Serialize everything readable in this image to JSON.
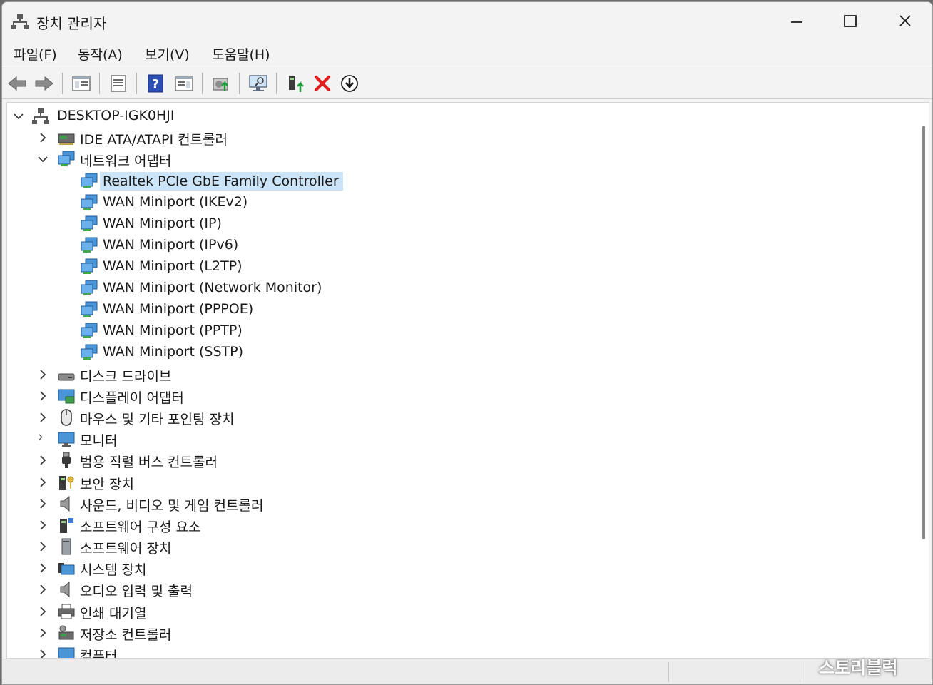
{
  "window": {
    "title": "장치 관리자"
  },
  "menu": {
    "items": [
      "파일(F)",
      "동작(A)",
      "보기(V)",
      "도움말(H)"
    ]
  },
  "toolbar": {
    "buttons": [
      "back-arrow-icon",
      "forward-arrow-icon",
      "show-hide-tree-icon",
      "properties-icon",
      "help-icon",
      "action-pane-icon",
      "update-driver-icon",
      "scan-hardware-icon",
      "add-legacy-icon",
      "uninstall-icon",
      "disable-device-icon"
    ]
  },
  "tree": {
    "root": "DESKTOP-IGK0HJI",
    "nodes": [
      {
        "label": "IDE ATA/ATAPI 컨트롤러",
        "icon": "ide-controller-icon",
        "expanded": false
      },
      {
        "label": "네트워크 어댑터",
        "icon": "network-adapter-icon",
        "expanded": true,
        "children": [
          {
            "label": "Realtek PCIe GbE Family Controller",
            "selected": true
          },
          {
            "label": "WAN Miniport (IKEv2)"
          },
          {
            "label": "WAN Miniport (IP)"
          },
          {
            "label": "WAN Miniport (IPv6)"
          },
          {
            "label": "WAN Miniport (L2TP)"
          },
          {
            "label": "WAN Miniport (Network Monitor)"
          },
          {
            "label": "WAN Miniport (PPPOE)"
          },
          {
            "label": "WAN Miniport (PPTP)"
          },
          {
            "label": "WAN Miniport (SSTP)"
          }
        ]
      },
      {
        "label": "디스크 드라이브",
        "icon": "disk-drive-icon",
        "expanded": false
      },
      {
        "label": "디스플레이 어댑터",
        "icon": "display-adapter-icon",
        "expanded": false
      },
      {
        "label": "마우스 및 기타 포인팅 장치",
        "icon": "mouse-icon",
        "expanded": false
      },
      {
        "label": "모니터",
        "icon": "monitor-icon",
        "expanded": false
      },
      {
        "label": "범용 직렬 버스 컨트롤러",
        "icon": "usb-icon",
        "expanded": false
      },
      {
        "label": "보안 장치",
        "icon": "security-device-icon",
        "expanded": false
      },
      {
        "label": "사운드, 비디오 및 게임 컨트롤러",
        "icon": "speaker-icon",
        "expanded": false
      },
      {
        "label": "소프트웨어 구성 요소",
        "icon": "software-component-icon",
        "expanded": false
      },
      {
        "label": "소프트웨어 장치",
        "icon": "software-device-icon",
        "expanded": false
      },
      {
        "label": "시스템 장치",
        "icon": "system-device-icon",
        "expanded": false
      },
      {
        "label": "오디오 입력 및 출력",
        "icon": "audio-io-icon",
        "expanded": false
      },
      {
        "label": "인쇄 대기열",
        "icon": "printer-icon",
        "expanded": false
      },
      {
        "label": "저장소 컨트롤러",
        "icon": "storage-controller-icon",
        "expanded": false
      },
      {
        "label": "컴퓨터",
        "icon": "computer-icon",
        "expanded": false
      }
    ]
  },
  "watermark": "스토리블럭",
  "colors": {
    "selection": "#cce4f7",
    "close_x": "#e01e1e",
    "update_arrow": "#1e9e3a"
  }
}
